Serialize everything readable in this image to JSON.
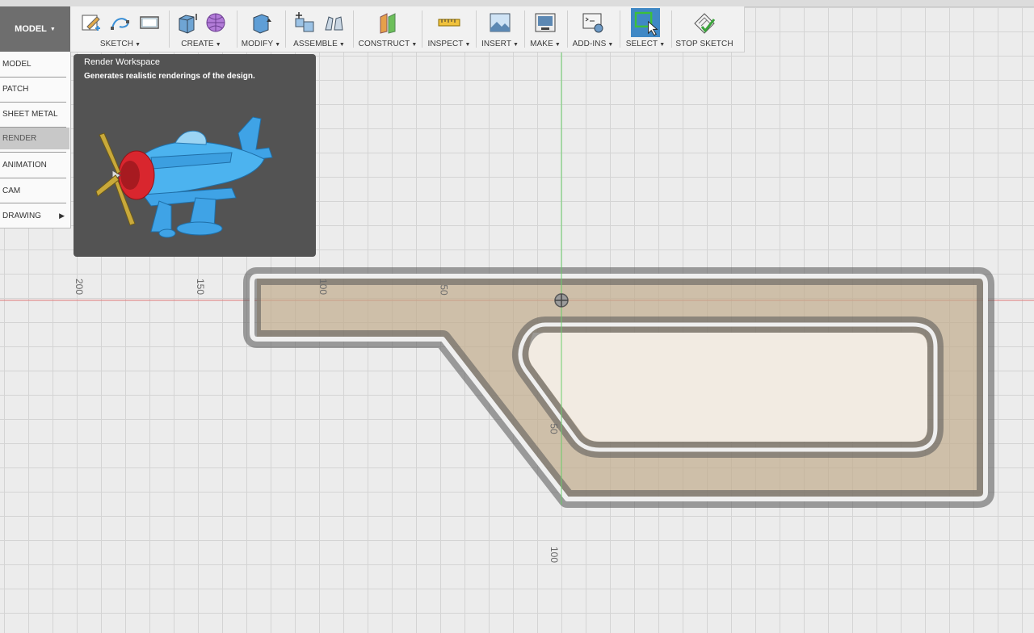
{
  "workspace": {
    "label": "MODEL"
  },
  "toolbar": {
    "groups": [
      {
        "label": "SKETCH",
        "icons": [
          "create-sketch-icon",
          "spline-icon",
          "rectangle-icon"
        ]
      },
      {
        "label": "CREATE",
        "icons": [
          "extrude-icon",
          "form-icon"
        ]
      },
      {
        "label": "MODIFY",
        "icons": [
          "press-pull-icon"
        ]
      },
      {
        "label": "ASSEMBLE",
        "icons": [
          "new-component-icon",
          "joint-icon"
        ]
      },
      {
        "label": "CONSTRUCT",
        "icons": [
          "offset-plane-icon"
        ]
      },
      {
        "label": "INSPECT",
        "icons": [
          "measure-icon"
        ]
      },
      {
        "label": "INSERT",
        "icons": [
          "insert-image-icon"
        ]
      },
      {
        "label": "MAKE",
        "icons": [
          "make-3d-print-icon"
        ]
      },
      {
        "label": "ADD-INS",
        "icons": [
          "scripts-addins-icon"
        ]
      },
      {
        "label": "SELECT",
        "icons": [
          "select-icon"
        ]
      },
      {
        "label": "STOP SKETCH",
        "icons": [
          "stop-sketch-icon"
        ]
      }
    ]
  },
  "workspace_menu": {
    "items": [
      "MODEL",
      "PATCH",
      "SHEET METAL",
      "RENDER",
      "ANIMATION",
      "CAM",
      "DRAWING"
    ],
    "active": "RENDER"
  },
  "tooltip": {
    "title": "Render Workspace",
    "description": "Generates realistic renderings of the design."
  },
  "ruler": {
    "horizontal": [
      "200",
      "150",
      "100",
      "50"
    ],
    "vertical": [
      "50",
      "100"
    ]
  },
  "colors": {
    "toolbar_bg": "#f1f1f1",
    "workspace_btn": "#6e6e6e",
    "active_item": "#c8c8c8",
    "tooltip_bg": "#535353",
    "part_fill": "#c6b49a",
    "x_axis": "#e06060",
    "y_axis": "#5cc35c",
    "select_highlight": "#3f88c5"
  }
}
